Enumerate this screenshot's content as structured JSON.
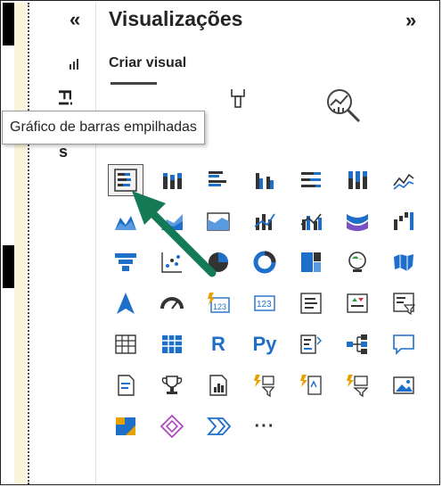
{
  "filters_pane": {
    "collapse_glyph": "«",
    "vertical_label": "Fi",
    "vertical_label_2": "s"
  },
  "visualizations": {
    "title": "Visualizações",
    "expand_glyph": "»",
    "subtitle": "Criar visual",
    "tooltip": "Gráfico de barras empilhadas"
  },
  "grid_text": {
    "r_label": "R",
    "py_label": "Py",
    "more_label": "···"
  },
  "colors": {
    "accent": "#1e6fc9",
    "arrow": "#137a55",
    "gold": "#e8a200"
  }
}
